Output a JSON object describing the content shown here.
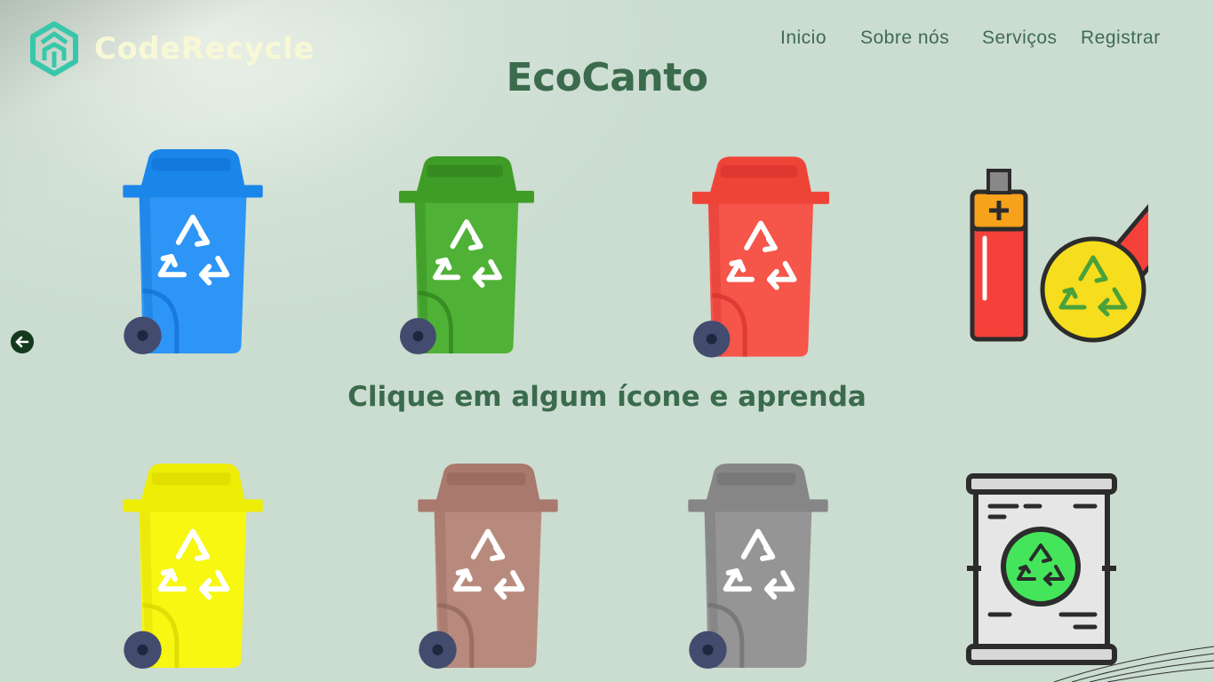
{
  "brand": {
    "name": "CodeRecycle",
    "logo_icon": "recycle-hex-logo"
  },
  "nav": {
    "items": [
      {
        "label": "Inicio"
      },
      {
        "label": "Sobre nós"
      },
      {
        "label": "Serviços"
      },
      {
        "label": "Registrar"
      }
    ]
  },
  "page": {
    "title": "EcoCanto",
    "subtitle": "Clique em algum ícone e aprenda"
  },
  "carousel": {
    "prev_icon": "arrow-left-icon"
  },
  "bins": [
    {
      "id": "blue",
      "icon": "recycle-bin-icon",
      "color": "#2d95f5",
      "lid": "#1a86ea",
      "stripe": "#0f6fd0"
    },
    {
      "id": "green",
      "icon": "recycle-bin-icon",
      "color": "#4fb237",
      "lid": "#3f9c26",
      "stripe": "#2f7e1b"
    },
    {
      "id": "red",
      "icon": "recycle-bin-icon",
      "color": "#f6554a",
      "lid": "#ee4438",
      "stripe": "#d3302a"
    },
    {
      "id": "battery",
      "icon": "battery-recycle-icon",
      "color": "#f5413a",
      "accent": "#f7a21b",
      "badge": "#f6dd1e"
    },
    {
      "id": "yellow",
      "icon": "recycle-bin-icon",
      "color": "#f7f711",
      "lid": "#eeed06",
      "stripe": "#d8d200"
    },
    {
      "id": "brown",
      "icon": "recycle-bin-icon",
      "color": "#b88a7d",
      "lid": "#a8796c",
      "stripe": "#8e6458"
    },
    {
      "id": "gray",
      "icon": "recycle-bin-icon",
      "color": "#959595",
      "lid": "#868686",
      "stripe": "#6d6d6d"
    },
    {
      "id": "barrel",
      "icon": "barrel-recycle-icon",
      "color": "#e6e6e6",
      "accent": "#45e55b",
      "outline": "#2c2c2c"
    }
  ],
  "colors": {
    "background": "#cbdcd0",
    "title_green": "#3a6b4c",
    "nav_text": "#3f6b55",
    "brand_text": "#f8f8d6",
    "logo_teal": "#38c7aa",
    "wheel": "#434b6e"
  }
}
